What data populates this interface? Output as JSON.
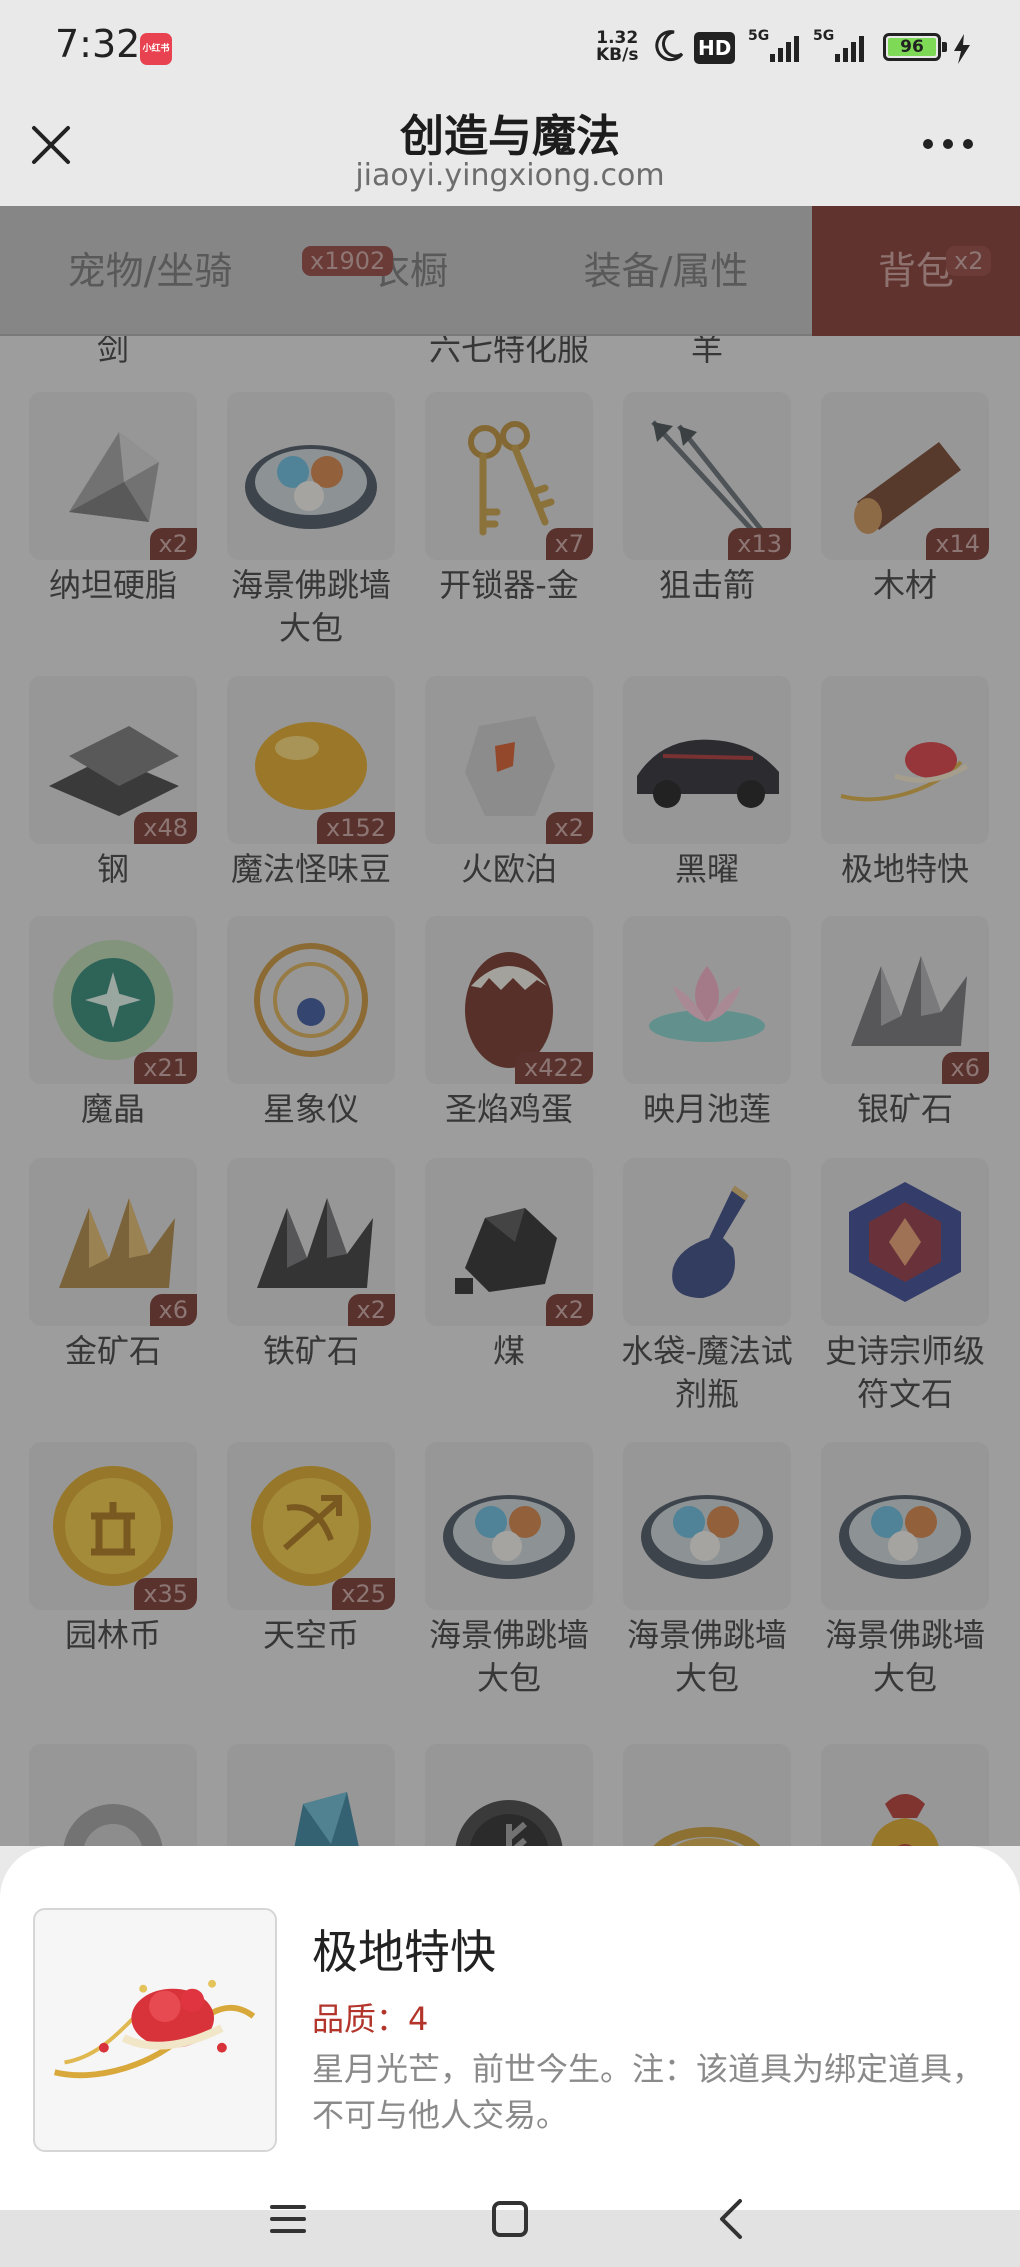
{
  "status_bar": {
    "time": "7:32",
    "app_badge": "小红书",
    "speed_value": "1.32",
    "speed_unit": "KB/s",
    "hd_label": "HD",
    "net1": "5G",
    "net2": "5G",
    "battery": "96"
  },
  "title_bar": {
    "title": "创造与魔法",
    "subtitle": "jiaoyi.yingxiong.com"
  },
  "tabs": [
    {
      "label": "宠物/坐骑",
      "badge": ""
    },
    {
      "label": "衣橱",
      "badge": "x1902"
    },
    {
      "label": "装备/属性",
      "badge": ""
    },
    {
      "label": "背包",
      "badge": "x2",
      "active": true
    }
  ],
  "cut_labels": [
    "剑",
    "六七特化服",
    "羊"
  ],
  "items": [
    {
      "name": "纳坦硬脂",
      "count": "x2",
      "icon": "grey-stone-icon"
    },
    {
      "name": "海景佛跳墙大包",
      "count": "",
      "icon": "food-platter-icon"
    },
    {
      "name": "开锁器-金",
      "count": "x7",
      "icon": "key-ring-icon"
    },
    {
      "name": "狙击箭",
      "count": "x13",
      "icon": "arrow-icon"
    },
    {
      "name": "木材",
      "count": "x14",
      "icon": "log-icon"
    },
    {
      "name": "钢",
      "count": "x48",
      "icon": "steel-ingot-icon"
    },
    {
      "name": "魔法怪味豆",
      "count": "x152",
      "icon": "golden-bean-icon"
    },
    {
      "name": "火欧泊",
      "count": "x2",
      "icon": "fire-opal-icon"
    },
    {
      "name": "黑曜",
      "count": "",
      "icon": "black-car-icon"
    },
    {
      "name": "极地特快",
      "count": "",
      "icon": "sleigh-icon"
    },
    {
      "name": "魔晶",
      "count": "x21",
      "icon": "magic-crystal-icon"
    },
    {
      "name": "星象仪",
      "count": "",
      "icon": "astrolabe-icon"
    },
    {
      "name": "圣焰鸡蛋",
      "count": "x422",
      "icon": "egg-icon"
    },
    {
      "name": "映月池莲",
      "count": "",
      "icon": "lotus-icon"
    },
    {
      "name": "银矿石",
      "count": "x6",
      "icon": "silver-ore-icon"
    },
    {
      "name": "金矿石",
      "count": "x6",
      "icon": "gold-ore-icon"
    },
    {
      "name": "铁矿石",
      "count": "x2",
      "icon": "iron-ore-icon"
    },
    {
      "name": "煤",
      "count": "x2",
      "icon": "coal-icon"
    },
    {
      "name": "水袋-魔法试剂瓶",
      "count": "",
      "icon": "potion-bottle-icon"
    },
    {
      "name": "史诗宗师级符文石",
      "count": "",
      "icon": "rune-stone-icon"
    },
    {
      "name": "园林币",
      "count": "x35",
      "icon": "garden-coin-icon"
    },
    {
      "name": "天空币",
      "count": "x25",
      "icon": "sky-coin-icon"
    },
    {
      "name": "海景佛跳墙大包",
      "count": "",
      "icon": "food-platter-icon"
    },
    {
      "name": "海景佛跳墙大包",
      "count": "",
      "icon": "food-platter-icon"
    },
    {
      "name": "海景佛跳墙大包",
      "count": "",
      "icon": "food-platter-icon"
    },
    {
      "name": "",
      "count": "",
      "icon": "silver-flower-icon"
    },
    {
      "name": "",
      "count": "",
      "icon": "blue-crystal-icon"
    },
    {
      "name": "",
      "count": "",
      "icon": "rune-disc-icon"
    },
    {
      "name": "",
      "count": "",
      "icon": "rope-icon"
    },
    {
      "name": "",
      "count": "",
      "icon": "lucky-bag-icon"
    }
  ],
  "detail": {
    "title": "极地特快",
    "quality_label": "品质：",
    "quality_value": "4",
    "description": "星月光芒，前世今生。注：该道具为绑定道具，不可与他人交易。"
  },
  "colors": {
    "accent": "#b2342a",
    "tab_active": "#7c2d26",
    "count_badge": "#6f2a24"
  }
}
